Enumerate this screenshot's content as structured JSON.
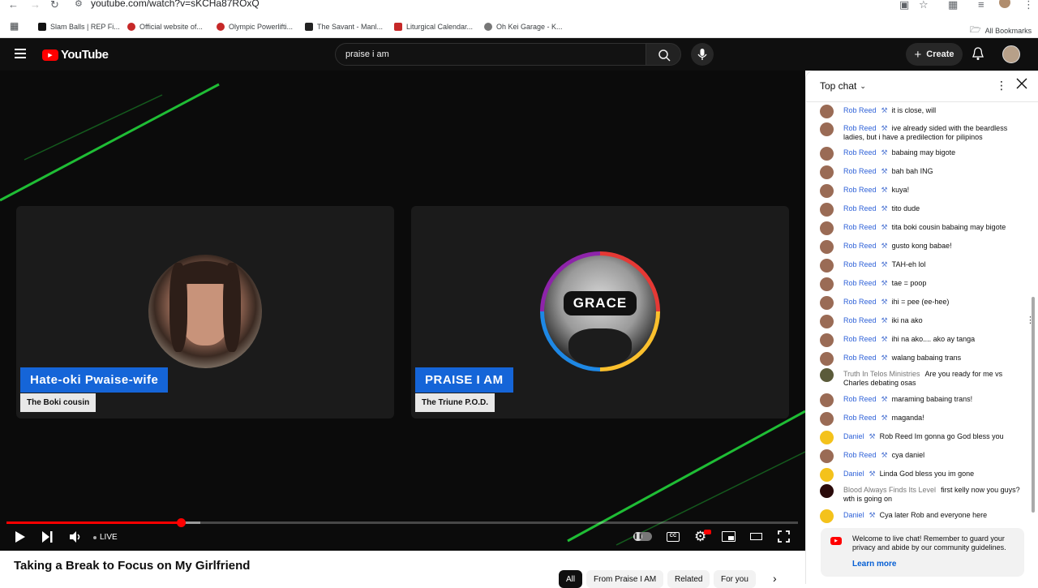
{
  "browser": {
    "url": "youtube.com/watch?v=sKCHa87ROxQ",
    "bookmarks": [
      {
        "label": "Slam Balls | REP Fi...",
        "color": "#111111"
      },
      {
        "label": "Official website of...",
        "color": "#c62828"
      },
      {
        "label": "Olympic Powerlifti...",
        "color": "#c62828"
      },
      {
        "label": "The Savant - Manl...",
        "color": "#222222"
      },
      {
        "label": "Liturgical Calendar...",
        "color": "#c62828"
      },
      {
        "label": "Oh Kei Garage - K...",
        "color": "#555555"
      }
    ],
    "all_bookmarks": "All Bookmarks"
  },
  "header": {
    "logo_text": "YouTube",
    "search_value": "praise i am",
    "create_label": "Create"
  },
  "video": {
    "left_name": "Hate-oki Pwaise-wife",
    "left_sub": "The Boki cousin",
    "right_name": "PRAISE I AM",
    "right_sub": "The Triune P.O.D.",
    "avatar_text": "GRACE",
    "live_label": "LIVE",
    "progress_fraction": 0.22,
    "buffered_fraction": 0.245,
    "title": "Taking a Break to Focus on My Girlfriend"
  },
  "chips": [
    {
      "label": "All",
      "active": true
    },
    {
      "label": "From Praise I AM",
      "active": false
    },
    {
      "label": "Related",
      "active": false
    },
    {
      "label": "For you",
      "active": false
    }
  ],
  "chat": {
    "mode_label": "Top chat",
    "messages": [
      {
        "author": "Rob Reed",
        "mod": true,
        "text": "it is close, will",
        "avatar": "#9a6b55"
      },
      {
        "author": "Rob Reed",
        "mod": true,
        "text": "ive already sided with the beardless ladies, but i have a predilection for pilipinos",
        "avatar": "#9a6b55"
      },
      {
        "author": "Rob Reed",
        "mod": true,
        "text": "babaing may bigote",
        "avatar": "#9a6b55"
      },
      {
        "author": "Rob Reed",
        "mod": true,
        "text": "bah bah ING",
        "avatar": "#9a6b55"
      },
      {
        "author": "Rob Reed",
        "mod": true,
        "text": "kuya!",
        "avatar": "#9a6b55"
      },
      {
        "author": "Rob Reed",
        "mod": true,
        "text": "tito dude",
        "avatar": "#9a6b55"
      },
      {
        "author": "Rob Reed",
        "mod": true,
        "text": "tita boki cousin babaing may bigote",
        "avatar": "#9a6b55"
      },
      {
        "author": "Rob Reed",
        "mod": true,
        "text": "gusto kong babae!",
        "avatar": "#9a6b55"
      },
      {
        "author": "Rob Reed",
        "mod": true,
        "text": "TAH-eh lol",
        "avatar": "#9a6b55"
      },
      {
        "author": "Rob Reed",
        "mod": true,
        "text": "tae = poop",
        "avatar": "#9a6b55"
      },
      {
        "author": "Rob Reed",
        "mod": true,
        "text": "ihi = pee (ee-hee)",
        "avatar": "#9a6b55"
      },
      {
        "author": "Rob Reed",
        "mod": true,
        "text": "iki na ako",
        "avatar": "#9a6b55"
      },
      {
        "author": "Rob Reed",
        "mod": true,
        "text": "ihi na ako.... ako ay tanga",
        "avatar": "#9a6b55"
      },
      {
        "author": "Rob Reed",
        "mod": true,
        "text": "walang babaing trans",
        "avatar": "#9a6b55"
      },
      {
        "author": "Truth In Telos Ministries",
        "mod": false,
        "text": "Are you ready for me vs Charles debating osas",
        "avatar": "#5b5b3a"
      },
      {
        "author": "Rob Reed",
        "mod": true,
        "text": "maraming babaing trans!",
        "avatar": "#9a6b55"
      },
      {
        "author": "Rob Reed",
        "mod": true,
        "text": "maganda!",
        "avatar": "#9a6b55"
      },
      {
        "author": "Daniel",
        "mod": true,
        "text": "Rob Reed Im gonna go God bless you",
        "avatar": "#f4c21b"
      },
      {
        "author": "Rob Reed",
        "mod": true,
        "text": "cya daniel",
        "avatar": "#9a6b55"
      },
      {
        "author": "Daniel",
        "mod": true,
        "text": "Linda God bless you im gone",
        "avatar": "#f4c21b"
      },
      {
        "author": "Blood Always Finds Its Level",
        "mod": false,
        "text": "first kelly now you guys? wth is going on",
        "avatar": "#2a0a0a"
      },
      {
        "author": "Daniel",
        "mod": true,
        "text": "Cya later Rob and everyone here",
        "avatar": "#f4c21b"
      }
    ],
    "welcome_text": "Welcome to live chat! Remember to guard your privacy and abide by our community guidelines.",
    "learn_more": "Learn more"
  }
}
